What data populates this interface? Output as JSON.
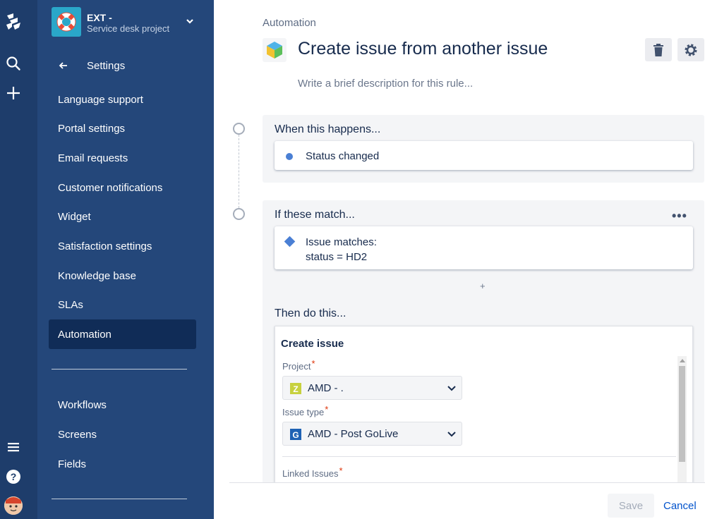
{
  "project": {
    "name": "EXT -",
    "type": "Service desk project"
  },
  "sidebar": {
    "back_label": "Settings",
    "items": [
      {
        "label": "Language support"
      },
      {
        "label": "Portal settings"
      },
      {
        "label": "Email requests"
      },
      {
        "label": "Customer notifications"
      },
      {
        "label": "Widget"
      },
      {
        "label": "Satisfaction settings"
      },
      {
        "label": "Knowledge base"
      },
      {
        "label": "SLAs"
      },
      {
        "label": "Automation",
        "active": true
      }
    ],
    "secondary_items": [
      {
        "label": "Workflows"
      },
      {
        "label": "Screens"
      },
      {
        "label": "Fields"
      }
    ]
  },
  "main": {
    "breadcrumb": "Automation",
    "title": "Create issue from another issue",
    "description_placeholder": "Write a brief description for this rule...",
    "when": {
      "heading": "When this happens...",
      "trigger": "Status changed"
    },
    "if": {
      "heading": "If these match...",
      "condition_line1": "Issue matches:",
      "condition_line2": "status = HD2",
      "add": "+"
    },
    "then": {
      "heading": "Then do this...",
      "action_title": "Create issue",
      "project_label": "Project",
      "project_value": "AMD - .",
      "issue_type_label": "Issue type",
      "issue_type_value": "AMD - Post GoLive",
      "linked_label": "Linked Issues",
      "required_mark": "*"
    },
    "more": "•••"
  },
  "footer": {
    "save_label": "Save",
    "cancel_label": "Cancel"
  },
  "colors": {
    "global_nav": "#1e3d6b",
    "sidebar": "#24477a",
    "active_item": "#102c57",
    "link": "#0052cc",
    "trigger_dot": "#4a7fd4"
  }
}
